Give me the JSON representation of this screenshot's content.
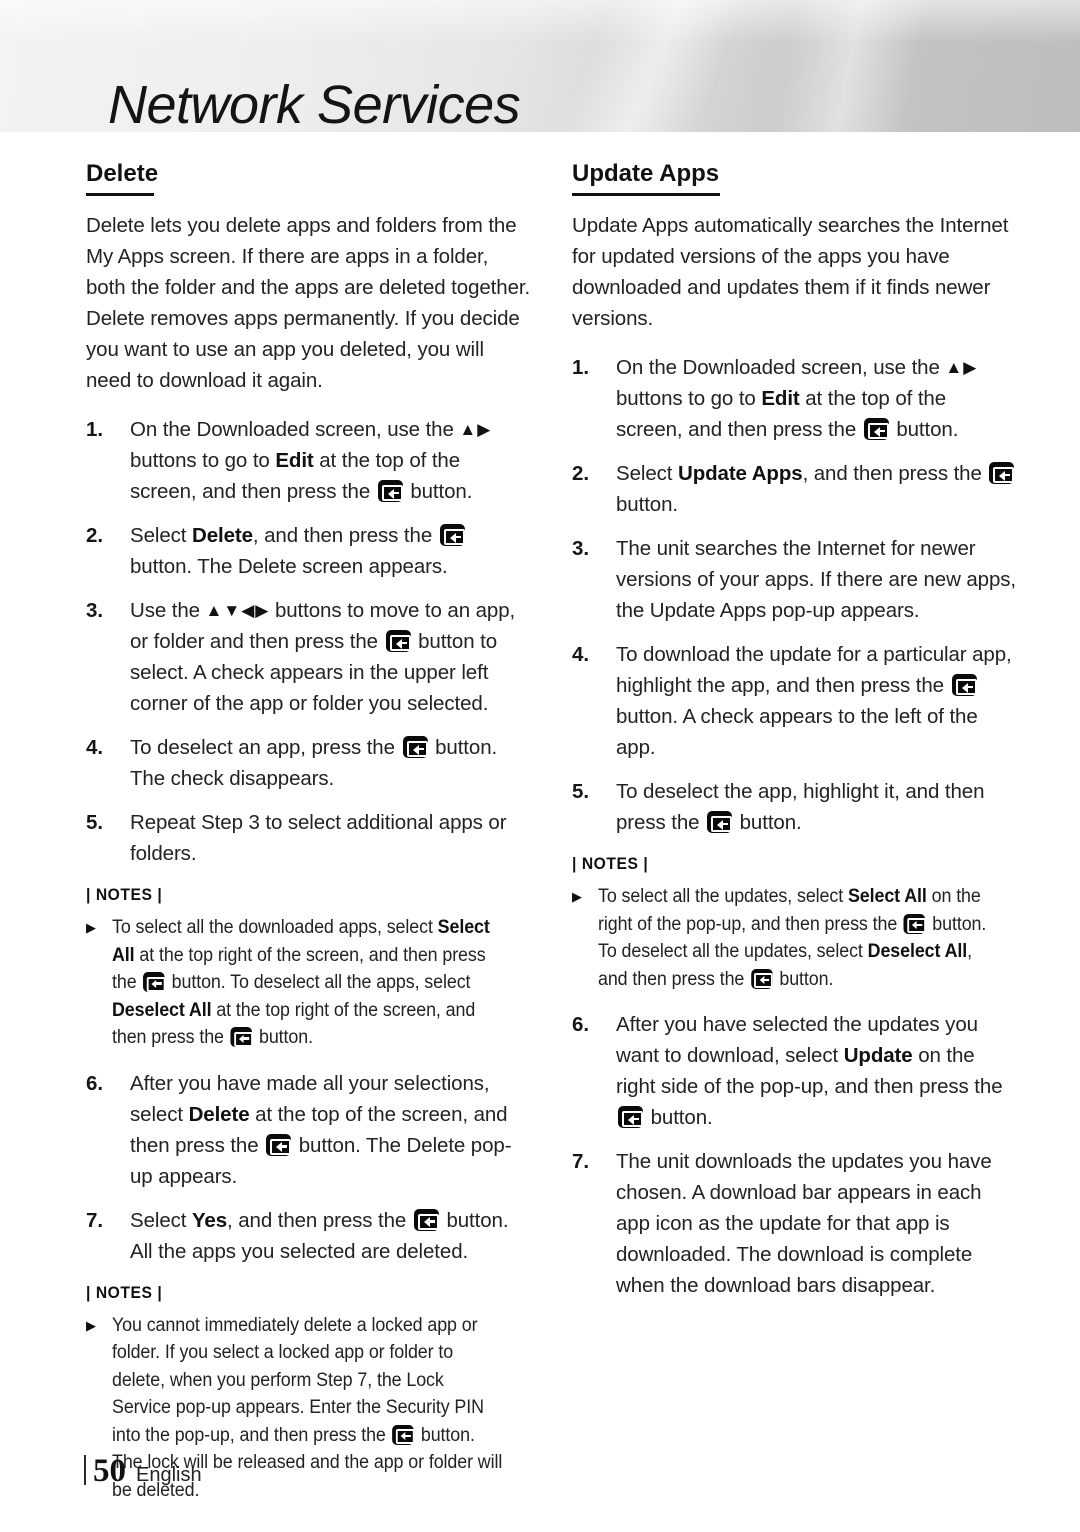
{
  "header": {
    "title": "Network Services"
  },
  "left_column": {
    "heading": "Delete",
    "intro": "Delete lets you delete apps and folders from the My Apps screen. If there are apps in a folder, both the folder and the apps are deleted together. Delete removes apps permanently. If you decide you want to use an app you deleted, you will need to download it again.",
    "steps": [
      {
        "num": "1.",
        "parts": [
          {
            "t": "text",
            "v": "On the Downloaded screen, use the "
          },
          {
            "t": "arrows",
            "v": "▲▶"
          },
          {
            "t": "text",
            "v": " buttons to go to "
          },
          {
            "t": "bold",
            "v": "Edit"
          },
          {
            "t": "text",
            "v": " at the top of the screen, and then press the "
          },
          {
            "t": "enter",
            "v": "enter-button-icon"
          },
          {
            "t": "text",
            "v": " button."
          }
        ]
      },
      {
        "num": "2.",
        "parts": [
          {
            "t": "text",
            "v": "Select "
          },
          {
            "t": "bold",
            "v": "Delete"
          },
          {
            "t": "text",
            "v": ", and then press the "
          },
          {
            "t": "enter",
            "v": "enter-button-icon"
          },
          {
            "t": "text",
            "v": " button. The Delete screen appears."
          }
        ]
      },
      {
        "num": "3.",
        "parts": [
          {
            "t": "text",
            "v": "Use the "
          },
          {
            "t": "arrows",
            "v": "▲▼◀▶"
          },
          {
            "t": "text",
            "v": " buttons to move to an app, or folder and then press the "
          },
          {
            "t": "enter",
            "v": "enter-button-icon"
          },
          {
            "t": "text",
            "v": " button to select. A check appears in the upper left corner of the app or folder you selected."
          }
        ]
      },
      {
        "num": "4.",
        "parts": [
          {
            "t": "text",
            "v": "To deselect an app, press the "
          },
          {
            "t": "enter",
            "v": "enter-button-icon"
          },
          {
            "t": "text",
            "v": " button. The check disappears."
          }
        ]
      },
      {
        "num": "5.",
        "parts": [
          {
            "t": "text",
            "v": "Repeat Step 3 to select additional apps or folders."
          }
        ]
      }
    ],
    "notes_1": {
      "title": "| NOTES |",
      "items": [
        {
          "bullet": "▶",
          "parts": [
            {
              "t": "text",
              "v": "To select all the downloaded apps, select "
            },
            {
              "t": "bold",
              "v": "Select All"
            },
            {
              "t": "text",
              "v": " at the top right of the screen, and then press the "
            },
            {
              "t": "enter",
              "v": "enter-button-icon"
            },
            {
              "t": "text",
              "v": " button. To deselect all the apps, select "
            },
            {
              "t": "bold",
              "v": "Deselect All"
            },
            {
              "t": "text",
              "v": " at the top right of the screen, and then press the "
            },
            {
              "t": "enter",
              "v": "enter-button-icon"
            },
            {
              "t": "text",
              "v": " button."
            }
          ]
        }
      ]
    },
    "steps_cont": [
      {
        "num": "6.",
        "parts": [
          {
            "t": "text",
            "v": "After you have made all your selections, select "
          },
          {
            "t": "bold",
            "v": "Delete"
          },
          {
            "t": "text",
            "v": " at the top of the screen, and then press the "
          },
          {
            "t": "enter",
            "v": "enter-button-icon"
          },
          {
            "t": "text",
            "v": " button. The Delete pop-up appears."
          }
        ]
      },
      {
        "num": "7.",
        "parts": [
          {
            "t": "text",
            "v": "Select "
          },
          {
            "t": "bold",
            "v": "Yes"
          },
          {
            "t": "text",
            "v": ", and then press the "
          },
          {
            "t": "enter",
            "v": "enter-button-icon"
          },
          {
            "t": "text",
            "v": " button. All the apps you selected are deleted."
          }
        ]
      }
    ],
    "notes_2": {
      "title": "| NOTES |",
      "items": [
        {
          "bullet": "▶",
          "parts": [
            {
              "t": "text",
              "v": "You cannot immediately delete a locked app or folder. If you select a locked app or folder to delete, when you perform Step 7, the Lock Service pop-up appears. Enter the Security PIN into the pop-up, and then press the "
            },
            {
              "t": "enter",
              "v": "enter-button-icon"
            },
            {
              "t": "text",
              "v": " button. The lock will be released and the app or folder will be deleted."
            }
          ]
        }
      ]
    }
  },
  "right_column": {
    "heading": "Update Apps",
    "intro": "Update Apps automatically searches the Internet for updated versions of the apps you have downloaded and updates them if it finds newer versions.",
    "steps": [
      {
        "num": "1.",
        "parts": [
          {
            "t": "text",
            "v": "On the Downloaded screen, use the "
          },
          {
            "t": "arrows",
            "v": "▲▶"
          },
          {
            "t": "text",
            "v": " buttons to go to "
          },
          {
            "t": "bold",
            "v": "Edit"
          },
          {
            "t": "text",
            "v": " at the top of the screen, and then press the "
          },
          {
            "t": "enter",
            "v": "enter-button-icon"
          },
          {
            "t": "text",
            "v": " button."
          }
        ]
      },
      {
        "num": "2.",
        "parts": [
          {
            "t": "text",
            "v": "Select "
          },
          {
            "t": "bold",
            "v": "Update Apps"
          },
          {
            "t": "text",
            "v": ", and then press the "
          },
          {
            "t": "enter",
            "v": "enter-button-icon"
          },
          {
            "t": "text",
            "v": " button."
          }
        ]
      },
      {
        "num": "3.",
        "parts": [
          {
            "t": "text",
            "v": "The unit searches the Internet for newer versions of your apps. If there are new apps, the Update Apps pop-up appears."
          }
        ]
      },
      {
        "num": "4.",
        "parts": [
          {
            "t": "text",
            "v": "To download the update for a particular app, highlight the app, and then press the "
          },
          {
            "t": "enter",
            "v": "enter-button-icon"
          },
          {
            "t": "text",
            "v": " button. A check appears to the left of the app."
          }
        ]
      },
      {
        "num": "5.",
        "parts": [
          {
            "t": "text",
            "v": "To deselect the app, highlight it, and then press the "
          },
          {
            "t": "enter",
            "v": "enter-button-icon"
          },
          {
            "t": "text",
            "v": " button."
          }
        ]
      }
    ],
    "notes_1": {
      "title": "| NOTES |",
      "items": [
        {
          "bullet": "▶",
          "parts": [
            {
              "t": "text",
              "v": "To select all the updates, select "
            },
            {
              "t": "bold",
              "v": "Select All"
            },
            {
              "t": "text",
              "v": " on the right of the pop-up, and then press the "
            },
            {
              "t": "enter",
              "v": "enter-button-icon"
            },
            {
              "t": "text",
              "v": " button. To deselect all the updates, select "
            },
            {
              "t": "bold",
              "v": "Deselect All"
            },
            {
              "t": "text",
              "v": ", and then press the "
            },
            {
              "t": "enter",
              "v": "enter-button-icon"
            },
            {
              "t": "text",
              "v": " button."
            }
          ]
        }
      ]
    },
    "steps_cont": [
      {
        "num": "6.",
        "parts": [
          {
            "t": "text",
            "v": "After you have selected the updates you want to download, select "
          },
          {
            "t": "bold",
            "v": "Update"
          },
          {
            "t": "text",
            "v": " on the right side of the pop-up, and then press the "
          },
          {
            "t": "enter",
            "v": "enter-button-icon"
          },
          {
            "t": "text",
            "v": " button."
          }
        ]
      },
      {
        "num": "7.",
        "parts": [
          {
            "t": "text",
            "v": "The unit downloads the updates you have chosen. A download bar appears in each app icon as the update for that app is downloaded. The download is complete when the download bars disappear."
          }
        ]
      }
    ]
  },
  "footer": {
    "page_number": "50",
    "language": "English"
  }
}
